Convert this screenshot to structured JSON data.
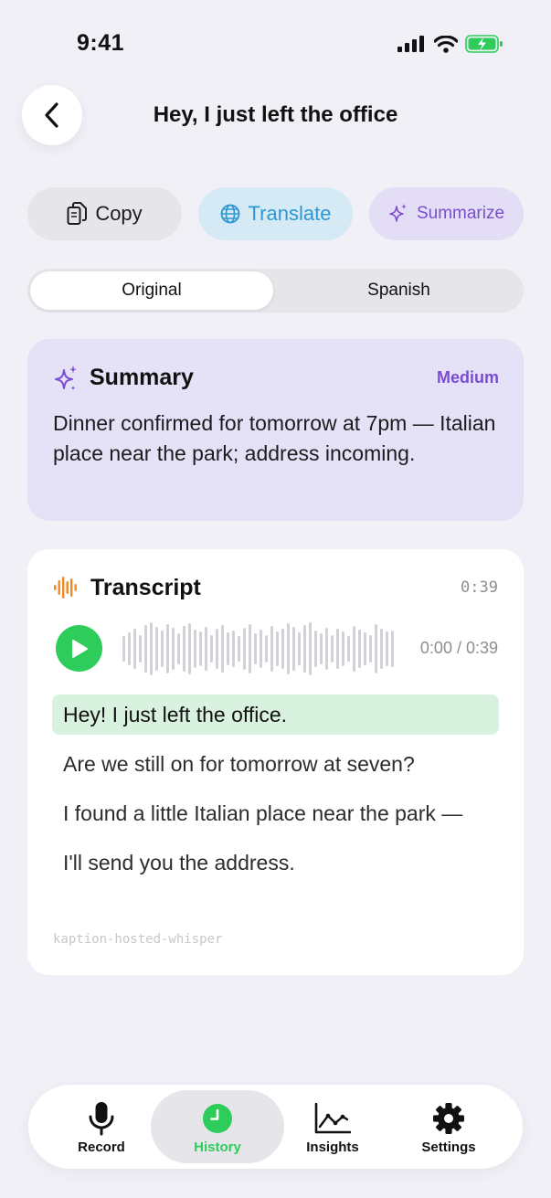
{
  "status_bar": {
    "time": "9:41"
  },
  "header": {
    "title": "Hey, I just left the office"
  },
  "actions": {
    "copy_label": "Copy",
    "translate_label": "Translate",
    "summarize_label": "Summarize"
  },
  "segmented": {
    "original": "Original",
    "spanish": "Spanish",
    "selected": "Original"
  },
  "summary": {
    "title": "Summary",
    "level": "Medium",
    "text": "Dinner confirmed for tomorrow at 7pm — Italian place near the park; address incoming."
  },
  "transcript": {
    "title": "Transcript",
    "duration": "0:39",
    "playback_time": "0:00 / 0:39",
    "progress": 0,
    "lines": [
      "Hey! I just left the office.",
      "Are we still on for tomorrow at seven?",
      "I found a little Italian place near the park —",
      "I'll send you the address."
    ],
    "active_line": 0,
    "model": "kaption-hosted-whisper"
  },
  "tab_bar": {
    "selected": "History",
    "items": [
      {
        "label": "Record",
        "icon": "mic-icon"
      },
      {
        "label": "History",
        "icon": "clock-icon"
      },
      {
        "label": "Insights",
        "icon": "chart-icon"
      },
      {
        "label": "Settings",
        "icon": "gear-icon"
      }
    ]
  },
  "colors": {
    "accent_green": "#2ECC5B",
    "translate_blue": "#2C97D3",
    "summary_purple": "#7A4DD0",
    "transcript_orange": "#F08A24"
  }
}
